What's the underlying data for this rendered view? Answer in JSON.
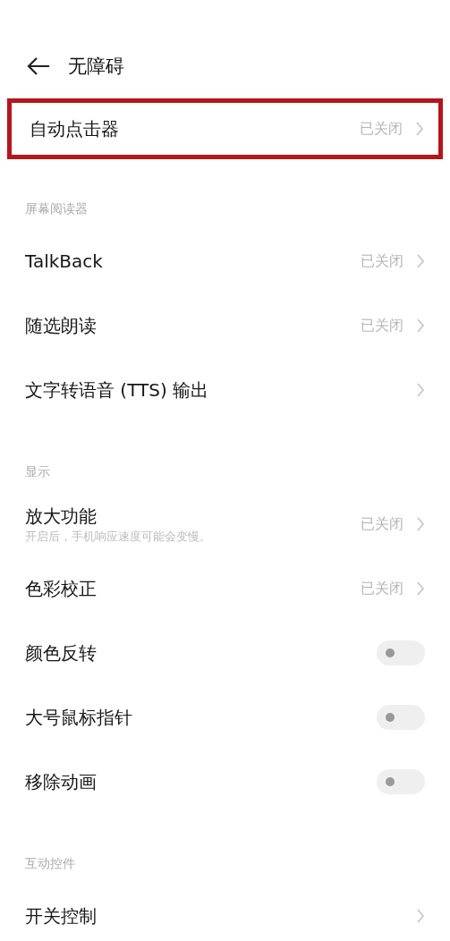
{
  "header": {
    "title": "无障碍"
  },
  "groups": [
    {
      "items": [
        {
          "kind": "link",
          "label": "自动点击器",
          "status": "已关闭",
          "highlighted": true
        }
      ]
    },
    {
      "title": "屏幕阅读器",
      "items": [
        {
          "kind": "link",
          "label": "TalkBack",
          "status": "已关闭",
          "highlighted": false
        },
        {
          "kind": "link",
          "label": "随选朗读",
          "status": "已关闭",
          "highlighted": false
        },
        {
          "kind": "link",
          "label": "文字转语音 (TTS) 输出",
          "highlighted": false
        }
      ]
    },
    {
      "title": "显示",
      "items": [
        {
          "kind": "link",
          "label": "放大功能",
          "subtitle": "开启后，手机响应速度可能会变慢。",
          "status": "已关闭",
          "highlighted": false
        },
        {
          "kind": "link",
          "label": "色彩校正",
          "status": "已关闭",
          "highlighted": false
        },
        {
          "kind": "toggle",
          "label": "颜色反转",
          "on": false,
          "highlighted": false
        },
        {
          "kind": "toggle",
          "label": "大号鼠标指针",
          "on": false,
          "highlighted": false
        },
        {
          "kind": "toggle",
          "label": "移除动画",
          "on": false,
          "highlighted": false
        }
      ]
    },
    {
      "title": "互动控件",
      "items": [
        {
          "kind": "link",
          "label": "开关控制",
          "highlighted": false
        }
      ]
    }
  ]
}
